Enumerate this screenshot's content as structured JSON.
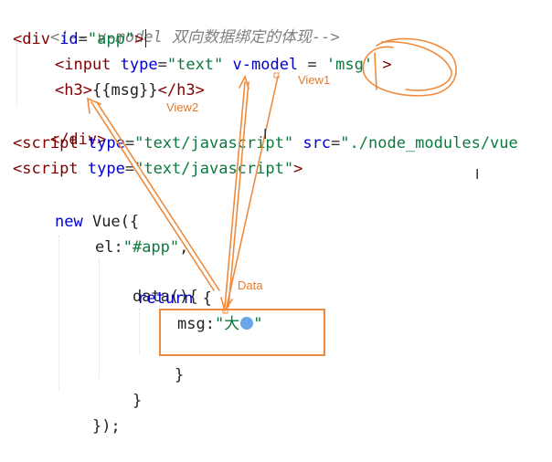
{
  "code": {
    "comment": "<!-- v-model 双向数据绑定的体现-->",
    "div_open": {
      "tag": "<div",
      "attr": " id",
      "eq": "=",
      "val": "\"app\"",
      "close": ">"
    },
    "input_line": {
      "tag": "<input",
      "a1": " type",
      "eq1": "=",
      "v1": "\"text\"",
      "a2": " v-model",
      "eq2": " = ",
      "v2": "'msg'",
      "close": " >"
    },
    "h3_line": {
      "open": "<h3",
      "gt": ">",
      "mustache": "{{msg}}",
      "close": "</h3",
      "gt2": ">"
    },
    "div_close": "</div>",
    "script1": {
      "tag": "<script",
      "a1": " type",
      "eq1": "=",
      "v1": "\"text/javascript\"",
      "a2": " src",
      "eq2": "=",
      "v2": "\"./node_modules/vue"
    },
    "script2": {
      "tag": "<script",
      "a1": " type",
      "eq1": "=",
      "v1": "\"text/javascript\"",
      "close": ">"
    },
    "new_vue": {
      "kw": "new",
      "rest": " Vue({"
    },
    "el_line": {
      "key": "el:",
      "val": "\"#app\"",
      "comma": ","
    },
    "data_line": "data(){",
    "return_line": {
      "kw": "return",
      "rest": " {"
    },
    "msg_line": {
      "key": "msg:",
      "q": "\"",
      "val": "大",
      "q2": "\""
    },
    "brace1": "}",
    "brace2": "}",
    "end_line": "});"
  },
  "annotations": {
    "view1": "View1",
    "view2": "View2",
    "data": "Data"
  },
  "cursor": "I",
  "colors": {
    "annotation": "#e8792a",
    "tag": "#800000",
    "attr": "#0000cc",
    "string": "#0b7a3e",
    "comment": "#808080"
  }
}
